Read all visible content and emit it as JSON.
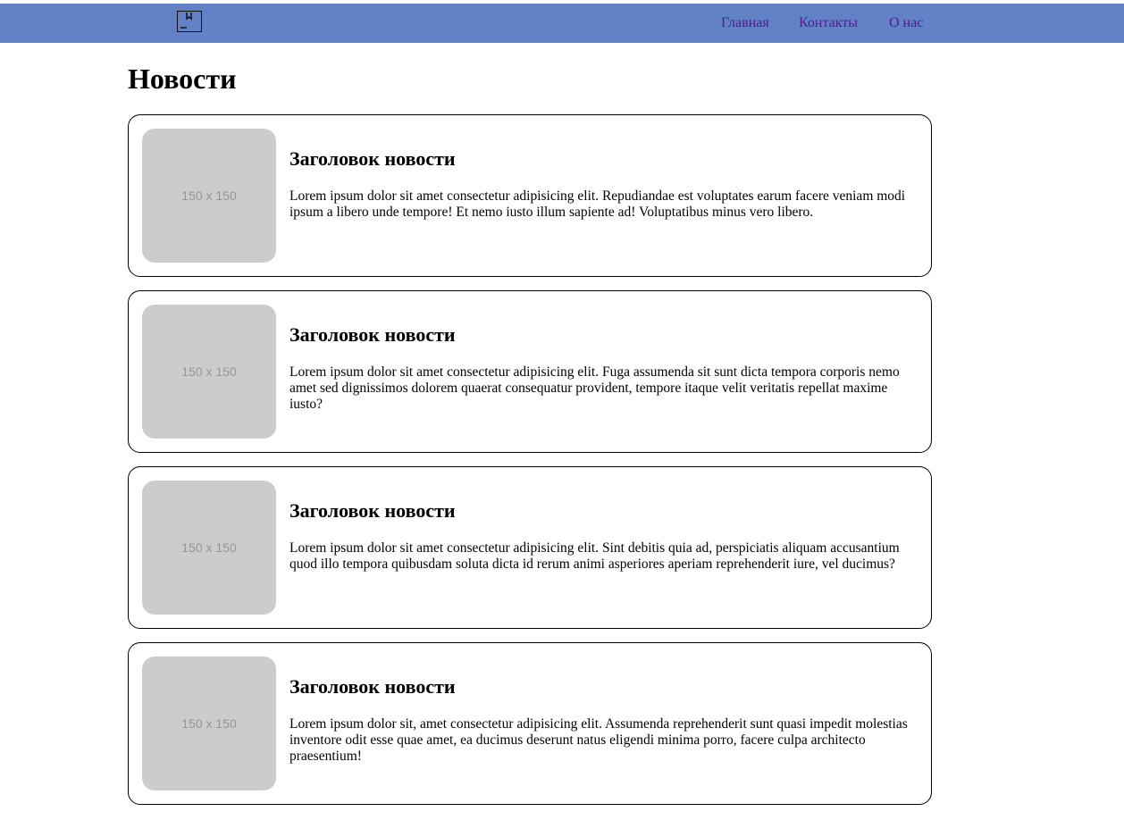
{
  "header": {
    "logo_icon": "bookmark-box-icon",
    "background_color": "#6282c8",
    "nav": [
      {
        "label": "Главная"
      },
      {
        "label": "Контакты"
      },
      {
        "label": "О нас"
      }
    ],
    "link_color": "#551a8b"
  },
  "page": {
    "title": "Новости"
  },
  "news": [
    {
      "image_placeholder": "150 x 150",
      "title": "Заголовок новости",
      "text": "Lorem ipsum dolor sit amet consectetur adipisicing elit. Repudiandae est voluptates earum facere veniam modi ipsum a libero unde tempore! Et nemo iusto illum sapiente ad! Voluptatibus minus vero libero."
    },
    {
      "image_placeholder": "150 x 150",
      "title": "Заголовок новости",
      "text": "Lorem ipsum dolor sit amet consectetur adipisicing elit. Fuga assumenda sit sunt dicta tempora corporis nemo amet sed dignissimos dolorem quaerat consequatur provident, tempore itaque velit veritatis repellat maxime iusto?"
    },
    {
      "image_placeholder": "150 x 150",
      "title": "Заголовок новости",
      "text": "Lorem ipsum dolor sit amet consectetur adipisicing elit. Sint debitis quia ad, perspiciatis aliquam accusantium quod illo tempora quibusdam soluta dicta id rerum animi asperiores aperiam reprehenderit iure, vel ducimus?"
    },
    {
      "image_placeholder": "150 x 150",
      "title": "Заголовок новости",
      "text": "Lorem ipsum dolor sit, amet consectetur adipisicing elit. Assumenda reprehenderit sunt quasi impedit molestias inventore odit esse quae amet, ea ducimus deserunt natus eligendi minima porro, facere culpa architecto praesentium!"
    }
  ]
}
